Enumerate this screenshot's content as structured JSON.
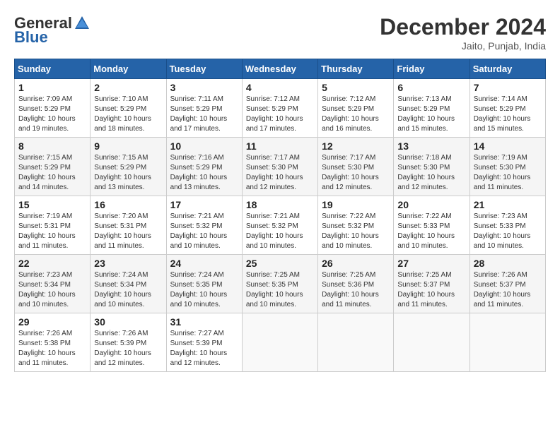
{
  "header": {
    "logo_line1": "General",
    "logo_line2": "Blue",
    "month": "December 2024",
    "location": "Jaito, Punjab, India"
  },
  "weekdays": [
    "Sunday",
    "Monday",
    "Tuesday",
    "Wednesday",
    "Thursday",
    "Friday",
    "Saturday"
  ],
  "weeks": [
    [
      {
        "day": "1",
        "info": "Sunrise: 7:09 AM\nSunset: 5:29 PM\nDaylight: 10 hours\nand 19 minutes."
      },
      {
        "day": "2",
        "info": "Sunrise: 7:10 AM\nSunset: 5:29 PM\nDaylight: 10 hours\nand 18 minutes."
      },
      {
        "day": "3",
        "info": "Sunrise: 7:11 AM\nSunset: 5:29 PM\nDaylight: 10 hours\nand 17 minutes."
      },
      {
        "day": "4",
        "info": "Sunrise: 7:12 AM\nSunset: 5:29 PM\nDaylight: 10 hours\nand 17 minutes."
      },
      {
        "day": "5",
        "info": "Sunrise: 7:12 AM\nSunset: 5:29 PM\nDaylight: 10 hours\nand 16 minutes."
      },
      {
        "day": "6",
        "info": "Sunrise: 7:13 AM\nSunset: 5:29 PM\nDaylight: 10 hours\nand 15 minutes."
      },
      {
        "day": "7",
        "info": "Sunrise: 7:14 AM\nSunset: 5:29 PM\nDaylight: 10 hours\nand 15 minutes."
      }
    ],
    [
      {
        "day": "8",
        "info": "Sunrise: 7:15 AM\nSunset: 5:29 PM\nDaylight: 10 hours\nand 14 minutes."
      },
      {
        "day": "9",
        "info": "Sunrise: 7:15 AM\nSunset: 5:29 PM\nDaylight: 10 hours\nand 13 minutes."
      },
      {
        "day": "10",
        "info": "Sunrise: 7:16 AM\nSunset: 5:29 PM\nDaylight: 10 hours\nand 13 minutes."
      },
      {
        "day": "11",
        "info": "Sunrise: 7:17 AM\nSunset: 5:30 PM\nDaylight: 10 hours\nand 12 minutes."
      },
      {
        "day": "12",
        "info": "Sunrise: 7:17 AM\nSunset: 5:30 PM\nDaylight: 10 hours\nand 12 minutes."
      },
      {
        "day": "13",
        "info": "Sunrise: 7:18 AM\nSunset: 5:30 PM\nDaylight: 10 hours\nand 12 minutes."
      },
      {
        "day": "14",
        "info": "Sunrise: 7:19 AM\nSunset: 5:30 PM\nDaylight: 10 hours\nand 11 minutes."
      }
    ],
    [
      {
        "day": "15",
        "info": "Sunrise: 7:19 AM\nSunset: 5:31 PM\nDaylight: 10 hours\nand 11 minutes."
      },
      {
        "day": "16",
        "info": "Sunrise: 7:20 AM\nSunset: 5:31 PM\nDaylight: 10 hours\nand 11 minutes."
      },
      {
        "day": "17",
        "info": "Sunrise: 7:21 AM\nSunset: 5:32 PM\nDaylight: 10 hours\nand 10 minutes."
      },
      {
        "day": "18",
        "info": "Sunrise: 7:21 AM\nSunset: 5:32 PM\nDaylight: 10 hours\nand 10 minutes."
      },
      {
        "day": "19",
        "info": "Sunrise: 7:22 AM\nSunset: 5:32 PM\nDaylight: 10 hours\nand 10 minutes."
      },
      {
        "day": "20",
        "info": "Sunrise: 7:22 AM\nSunset: 5:33 PM\nDaylight: 10 hours\nand 10 minutes."
      },
      {
        "day": "21",
        "info": "Sunrise: 7:23 AM\nSunset: 5:33 PM\nDaylight: 10 hours\nand 10 minutes."
      }
    ],
    [
      {
        "day": "22",
        "info": "Sunrise: 7:23 AM\nSunset: 5:34 PM\nDaylight: 10 hours\nand 10 minutes."
      },
      {
        "day": "23",
        "info": "Sunrise: 7:24 AM\nSunset: 5:34 PM\nDaylight: 10 hours\nand 10 minutes."
      },
      {
        "day": "24",
        "info": "Sunrise: 7:24 AM\nSunset: 5:35 PM\nDaylight: 10 hours\nand 10 minutes."
      },
      {
        "day": "25",
        "info": "Sunrise: 7:25 AM\nSunset: 5:35 PM\nDaylight: 10 hours\nand 10 minutes."
      },
      {
        "day": "26",
        "info": "Sunrise: 7:25 AM\nSunset: 5:36 PM\nDaylight: 10 hours\nand 11 minutes."
      },
      {
        "day": "27",
        "info": "Sunrise: 7:25 AM\nSunset: 5:37 PM\nDaylight: 10 hours\nand 11 minutes."
      },
      {
        "day": "28",
        "info": "Sunrise: 7:26 AM\nSunset: 5:37 PM\nDaylight: 10 hours\nand 11 minutes."
      }
    ],
    [
      {
        "day": "29",
        "info": "Sunrise: 7:26 AM\nSunset: 5:38 PM\nDaylight: 10 hours\nand 11 minutes."
      },
      {
        "day": "30",
        "info": "Sunrise: 7:26 AM\nSunset: 5:39 PM\nDaylight: 10 hours\nand 12 minutes."
      },
      {
        "day": "31",
        "info": "Sunrise: 7:27 AM\nSunset: 5:39 PM\nDaylight: 10 hours\nand 12 minutes."
      },
      {
        "day": "",
        "info": ""
      },
      {
        "day": "",
        "info": ""
      },
      {
        "day": "",
        "info": ""
      },
      {
        "day": "",
        "info": ""
      }
    ]
  ]
}
